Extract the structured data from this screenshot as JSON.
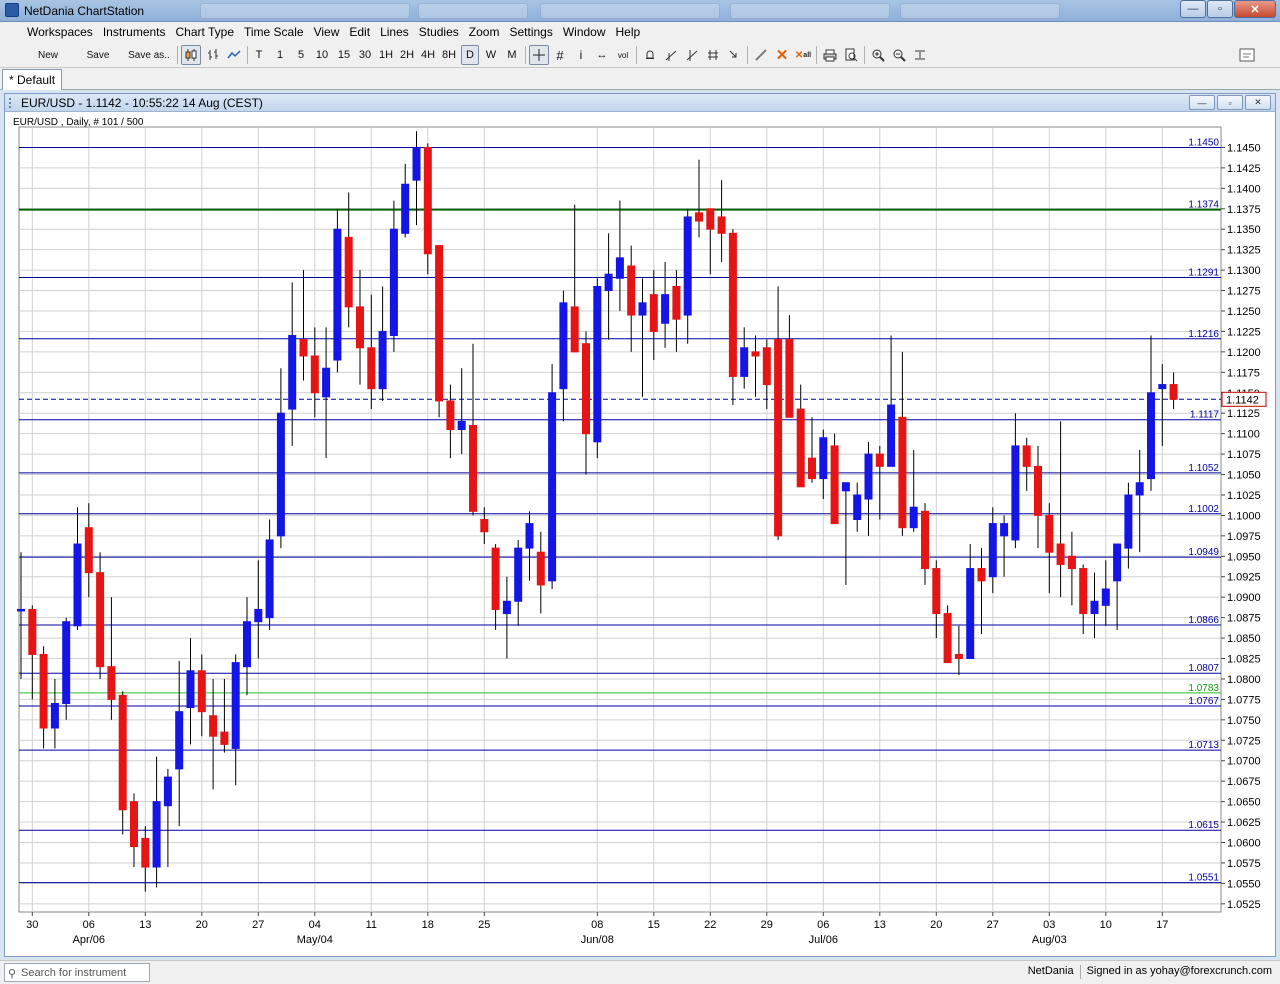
{
  "app": {
    "title": "NetDania ChartStation"
  },
  "window_buttons": {
    "minimize": "—",
    "maximize": "▫",
    "close": "✕"
  },
  "menu": [
    "Workspaces",
    "Instruments",
    "Chart Type",
    "Time Scale",
    "View",
    "Edit",
    "Lines",
    "Studies",
    "Zoom",
    "Settings",
    "Window",
    "Help"
  ],
  "toolbar": {
    "new_label": "New",
    "save_label": "Save",
    "save_as_label": "Save as..",
    "timescales": [
      "T",
      "1",
      "5",
      "10",
      "15",
      "30",
      "1H",
      "2H",
      "4H",
      "8H",
      "D",
      "W",
      "M"
    ],
    "selected_timescale": "D",
    "icons": [
      "candles-icon",
      "bars-icon",
      "line-icon",
      "crosshair-icon",
      "grid-icon",
      "info-icon",
      "arrows-icon",
      "volume-icon",
      "bell-icon",
      "trendline-icon",
      "trend-channel-icon",
      "fork-icon",
      "cursor-arrow-icon",
      "pencil-icon",
      "delete-icon",
      "delete-all-icon",
      "print-icon",
      "print-preview-icon",
      "zoom-in-icon",
      "zoom-out-icon",
      "fit-icon",
      "panel-icon"
    ]
  },
  "workspace_tab": {
    "label": "Default"
  },
  "chart_window": {
    "title": "EUR/USD - 1.1142 - 10:55:22  14 Aug (CEST)",
    "subtitle": "EUR/USD , Daily, # 101 / 500",
    "current_price_label": "1.1142"
  },
  "colors": {
    "up": "#1515e6",
    "down": "#e61515",
    "hline": "#0000a0",
    "hline_green": "#006000",
    "hline_lightgreen": "#22c022",
    "grid": "#d0d0d0",
    "price_box": "#c00000"
  },
  "chart_data": {
    "type": "candlestick",
    "instrument": "EUR/USD",
    "interval": "Daily",
    "ylim": [
      1.0515,
      1.1475
    ],
    "y_ticks": [
      "1.1450",
      "1.1425",
      "1.1400",
      "1.1375",
      "1.1350",
      "1.1325",
      "1.1300",
      "1.1275",
      "1.1250",
      "1.1225",
      "1.1200",
      "1.1175",
      "1.1150",
      "1.1125",
      "1.1100",
      "1.1075",
      "1.1050",
      "1.1025",
      "1.1000",
      "1.0975",
      "1.0950",
      "1.0925",
      "1.0900",
      "1.0875",
      "1.0850",
      "1.0825",
      "1.0800",
      "1.0775",
      "1.0750",
      "1.0725",
      "1.0700",
      "1.0675",
      "1.0650",
      "1.0625",
      "1.0600",
      "1.0575",
      "1.0550",
      "1.0525"
    ],
    "x_ticks": [
      {
        "label": "30",
        "bar": 1
      },
      {
        "label": "06",
        "bar": 6
      },
      {
        "label": "13",
        "bar": 11
      },
      {
        "label": "20",
        "bar": 16
      },
      {
        "label": "27",
        "bar": 21
      },
      {
        "label": "04",
        "bar": 26
      },
      {
        "label": "11",
        "bar": 31
      },
      {
        "label": "18",
        "bar": 36
      },
      {
        "label": "25",
        "bar": 41
      },
      {
        "label": "08",
        "bar": 51
      },
      {
        "label": "15",
        "bar": 56
      },
      {
        "label": "22",
        "bar": 61
      },
      {
        "label": "29",
        "bar": 66
      },
      {
        "label": "06",
        "bar": 71
      },
      {
        "label": "13",
        "bar": 76
      },
      {
        "label": "20",
        "bar": 81
      },
      {
        "label": "27",
        "bar": 86
      },
      {
        "label": "03",
        "bar": 91
      },
      {
        "label": "10",
        "bar": 96
      },
      {
        "label": "17",
        "bar": 101
      }
    ],
    "x_month_labels": [
      {
        "label": "Apr/06",
        "bar": 6
      },
      {
        "label": "May/04",
        "bar": 26
      },
      {
        "label": "Jun/08",
        "bar": 51
      },
      {
        "label": "Jul/06",
        "bar": 71
      },
      {
        "label": "Aug/03",
        "bar": 91
      }
    ],
    "horizontal_lines": [
      {
        "value": 1.145,
        "label": "1.1450",
        "style": "blue"
      },
      {
        "value": 1.1374,
        "label": "1.1374",
        "style": "green"
      },
      {
        "value": 1.1291,
        "label": "1.1291",
        "style": "blue"
      },
      {
        "value": 1.1216,
        "label": "1.1216",
        "style": "blue"
      },
      {
        "value": 1.1117,
        "label": "1.1117",
        "style": "blue"
      },
      {
        "value": 1.1052,
        "label": "1.1052",
        "style": "blue"
      },
      {
        "value": 1.1002,
        "label": "1.1002",
        "style": "blue"
      },
      {
        "value": 1.0949,
        "label": "1.0949",
        "style": "blue"
      },
      {
        "value": 1.0866,
        "label": "1.0866",
        "style": "blue"
      },
      {
        "value": 1.0807,
        "label": "1.0807",
        "style": "blue"
      },
      {
        "value": 1.0783,
        "label": "1.0783",
        "style": "lightgreen"
      },
      {
        "value": 1.0767,
        "label": "1.0767",
        "style": "blue"
      },
      {
        "value": 1.0713,
        "label": "1.0713",
        "style": "blue"
      },
      {
        "value": 1.0615,
        "label": "1.0615",
        "style": "blue"
      },
      {
        "value": 1.0551,
        "label": "1.0551",
        "style": "blue"
      }
    ],
    "current_price": 1.1142,
    "candles": [
      {
        "o": 1.0885,
        "h": 1.0955,
        "l": 1.08,
        "c": 1.0885
      },
      {
        "o": 1.0885,
        "h": 1.089,
        "l": 1.0775,
        "c": 1.083
      },
      {
        "o": 1.083,
        "h": 1.084,
        "l": 1.0715,
        "c": 1.074
      },
      {
        "o": 1.074,
        "h": 1.08,
        "l": 1.0715,
        "c": 1.077
      },
      {
        "o": 1.077,
        "h": 1.0875,
        "l": 1.075,
        "c": 1.087
      },
      {
        "o": 1.0865,
        "h": 1.101,
        "l": 1.086,
        "c": 1.0965
      },
      {
        "o": 1.0985,
        "h": 1.1015,
        "l": 1.09,
        "c": 1.093
      },
      {
        "o": 1.093,
        "h": 1.0955,
        "l": 1.08,
        "c": 1.0815
      },
      {
        "o": 1.0815,
        "h": 1.09,
        "l": 1.075,
        "c": 1.0775
      },
      {
        "o": 1.078,
        "h": 1.0785,
        "l": 1.061,
        "c": 1.064
      },
      {
        "o": 1.065,
        "h": 1.066,
        "l": 1.057,
        "c": 1.0595
      },
      {
        "o": 1.0605,
        "h": 1.062,
        "l": 1.054,
        "c": 1.057
      },
      {
        "o": 1.057,
        "h": 1.0705,
        "l": 1.0545,
        "c": 1.065
      },
      {
        "o": 1.0645,
        "h": 1.069,
        "l": 1.057,
        "c": 1.068
      },
      {
        "o": 1.069,
        "h": 1.0822,
        "l": 1.062,
        "c": 1.076
      },
      {
        "o": 1.0765,
        "h": 1.085,
        "l": 1.072,
        "c": 1.081
      },
      {
        "o": 1.081,
        "h": 1.083,
        "l": 1.073,
        "c": 1.076
      },
      {
        "o": 1.0755,
        "h": 1.08,
        "l": 1.0665,
        "c": 1.073
      },
      {
        "o": 1.0735,
        "h": 1.08,
        "l": 1.071,
        "c": 1.072
      },
      {
        "o": 1.0715,
        "h": 1.083,
        "l": 1.067,
        "c": 1.082
      },
      {
        "o": 1.0815,
        "h": 1.09,
        "l": 1.078,
        "c": 1.087
      },
      {
        "o": 1.087,
        "h": 1.0945,
        "l": 1.0825,
        "c": 1.0885
      },
      {
        "o": 1.0875,
        "h": 1.0995,
        "l": 1.086,
        "c": 1.097
      },
      {
        "o": 1.0975,
        "h": 1.118,
        "l": 1.096,
        "c": 1.1125
      },
      {
        "o": 1.113,
        "h": 1.1285,
        "l": 1.1085,
        "c": 1.122
      },
      {
        "o": 1.1215,
        "h": 1.13,
        "l": 1.1165,
        "c": 1.1195
      },
      {
        "o": 1.1195,
        "h": 1.123,
        "l": 1.112,
        "c": 1.115
      },
      {
        "o": 1.1145,
        "h": 1.123,
        "l": 1.107,
        "c": 1.118
      },
      {
        "o": 1.119,
        "h": 1.1375,
        "l": 1.1175,
        "c": 1.135
      },
      {
        "o": 1.134,
        "h": 1.1395,
        "l": 1.123,
        "c": 1.1255
      },
      {
        "o": 1.1255,
        "h": 1.13,
        "l": 1.116,
        "c": 1.1205
      },
      {
        "o": 1.1205,
        "h": 1.127,
        "l": 1.113,
        "c": 1.1155
      },
      {
        "o": 1.1155,
        "h": 1.128,
        "l": 1.114,
        "c": 1.1225
      },
      {
        "o": 1.122,
        "h": 1.1385,
        "l": 1.12,
        "c": 1.135
      },
      {
        "o": 1.1345,
        "h": 1.143,
        "l": 1.134,
        "c": 1.1405
      },
      {
        "o": 1.141,
        "h": 1.147,
        "l": 1.1355,
        "c": 1.145
      },
      {
        "o": 1.145,
        "h": 1.1455,
        "l": 1.1295,
        "c": 1.132
      },
      {
        "o": 1.133,
        "h": 1.133,
        "l": 1.112,
        "c": 1.114
      },
      {
        "o": 1.114,
        "h": 1.116,
        "l": 1.107,
        "c": 1.1105
      },
      {
        "o": 1.1105,
        "h": 1.118,
        "l": 1.1075,
        "c": 1.1115
      },
      {
        "o": 1.111,
        "h": 1.121,
        "l": 1.1,
        "c": 1.1005
      },
      {
        "o": 1.0995,
        "h": 1.101,
        "l": 1.0965,
        "c": 1.098
      },
      {
        "o": 1.096,
        "h": 1.0965,
        "l": 1.086,
        "c": 1.0885
      },
      {
        "o": 1.088,
        "h": 1.0925,
        "l": 1.0825,
        "c": 1.0895
      },
      {
        "o": 1.0895,
        "h": 1.097,
        "l": 1.0865,
        "c": 1.096
      },
      {
        "o": 1.096,
        "h": 1.1005,
        "l": 1.092,
        "c": 1.099
      },
      {
        "o": 1.0955,
        "h": 1.098,
        "l": 1.088,
        "c": 1.0915
      },
      {
        "o": 1.092,
        "h": 1.1185,
        "l": 1.091,
        "c": 1.115
      },
      {
        "o": 1.1155,
        "h": 1.1275,
        "l": 1.1115,
        "c": 1.126
      },
      {
        "o": 1.1255,
        "h": 1.138,
        "l": 1.12,
        "c": 1.12
      },
      {
        "o": 1.121,
        "h": 1.1225,
        "l": 1.105,
        "c": 1.11
      },
      {
        "o": 1.109,
        "h": 1.129,
        "l": 1.107,
        "c": 1.128
      },
      {
        "o": 1.1275,
        "h": 1.1345,
        "l": 1.1215,
        "c": 1.1295
      },
      {
        "o": 1.129,
        "h": 1.1385,
        "l": 1.125,
        "c": 1.1315
      },
      {
        "o": 1.1305,
        "h": 1.133,
        "l": 1.12,
        "c": 1.1245
      },
      {
        "o": 1.1245,
        "h": 1.129,
        "l": 1.1145,
        "c": 1.126
      },
      {
        "o": 1.127,
        "h": 1.13,
        "l": 1.119,
        "c": 1.1225
      },
      {
        "o": 1.1235,
        "h": 1.131,
        "l": 1.1205,
        "c": 1.127
      },
      {
        "o": 1.128,
        "h": 1.13,
        "l": 1.12,
        "c": 1.124
      },
      {
        "o": 1.1245,
        "h": 1.1375,
        "l": 1.121,
        "c": 1.1365
      },
      {
        "o": 1.137,
        "h": 1.1435,
        "l": 1.134,
        "c": 1.136
      },
      {
        "o": 1.1375,
        "h": 1.137,
        "l": 1.1295,
        "c": 1.135
      },
      {
        "o": 1.1365,
        "h": 1.141,
        "l": 1.131,
        "c": 1.1345
      },
      {
        "o": 1.1345,
        "h": 1.135,
        "l": 1.1135,
        "c": 1.117
      },
      {
        "o": 1.117,
        "h": 1.123,
        "l": 1.1155,
        "c": 1.1205
      },
      {
        "o": 1.12,
        "h": 1.122,
        "l": 1.1145,
        "c": 1.1195
      },
      {
        "o": 1.1205,
        "h": 1.1215,
        "l": 1.113,
        "c": 1.116
      },
      {
        "o": 1.1215,
        "h": 1.128,
        "l": 1.097,
        "c": 1.0975
      },
      {
        "o": 1.1215,
        "h": 1.1245,
        "l": 1.112,
        "c": 1.112
      },
      {
        "o": 1.113,
        "h": 1.116,
        "l": 1.1035,
        "c": 1.1035
      },
      {
        "o": 1.107,
        "h": 1.112,
        "l": 1.104,
        "c": 1.1045
      },
      {
        "o": 1.1045,
        "h": 1.1105,
        "l": 1.102,
        "c": 1.1095
      },
      {
        "o": 1.1085,
        "h": 1.11,
        "l": 1.099,
        "c": 1.099
      },
      {
        "o": 1.103,
        "h": 1.104,
        "l": 1.0915,
        "c": 1.104
      },
      {
        "o": 1.0995,
        "h": 1.104,
        "l": 1.098,
        "c": 1.1025
      },
      {
        "o": 1.102,
        "h": 1.109,
        "l": 1.0975,
        "c": 1.1075
      },
      {
        "o": 1.1075,
        "h": 1.1085,
        "l": 1.0995,
        "c": 1.106
      },
      {
        "o": 1.106,
        "h": 1.122,
        "l": 1.106,
        "c": 1.1135
      },
      {
        "o": 1.112,
        "h": 1.12,
        "l": 1.0975,
        "c": 1.0985
      },
      {
        "o": 1.0985,
        "h": 1.108,
        "l": 1.098,
        "c": 1.101
      },
      {
        "o": 1.1005,
        "h": 1.1015,
        "l": 1.0915,
        "c": 1.0935
      },
      {
        "o": 1.0935,
        "h": 1.0945,
        "l": 1.085,
        "c": 1.088
      },
      {
        "o": 1.088,
        "h": 1.089,
        "l": 1.082,
        "c": 1.082
      },
      {
        "o": 1.083,
        "h": 1.0865,
        "l": 1.0805,
        "c": 1.0825
      },
      {
        "o": 1.0825,
        "h": 1.0965,
        "l": 1.0825,
        "c": 1.0935
      },
      {
        "o": 1.0935,
        "h": 1.096,
        "l": 1.0855,
        "c": 1.092
      },
      {
        "o": 1.0925,
        "h": 1.101,
        "l": 1.0905,
        "c": 1.099
      },
      {
        "o": 1.0975,
        "h": 1.1,
        "l": 1.0925,
        "c": 1.099
      },
      {
        "o": 1.097,
        "h": 1.1125,
        "l": 1.096,
        "c": 1.1085
      },
      {
        "o": 1.1085,
        "h": 1.1095,
        "l": 1.103,
        "c": 1.106
      },
      {
        "o": 1.106,
        "h": 1.1085,
        "l": 1.096,
        "c": 1.1
      },
      {
        "o": 1.1,
        "h": 1.1015,
        "l": 1.0905,
        "c": 1.0955
      },
      {
        "o": 1.0965,
        "h": 1.1115,
        "l": 1.09,
        "c": 1.094
      },
      {
        "o": 1.095,
        "h": 1.098,
        "l": 1.089,
        "c": 1.0935
      },
      {
        "o": 1.0935,
        "h": 1.094,
        "l": 1.0855,
        "c": 1.088
      },
      {
        "o": 1.088,
        "h": 1.093,
        "l": 1.085,
        "c": 1.0895
      },
      {
        "o": 1.089,
        "h": 1.0945,
        "l": 1.0865,
        "c": 1.091
      },
      {
        "o": 1.092,
        "h": 1.096,
        "l": 1.086,
        "c": 1.0965
      },
      {
        "o": 1.096,
        "h": 1.104,
        "l": 1.0935,
        "c": 1.1025
      },
      {
        "o": 1.1025,
        "h": 1.108,
        "l": 1.0955,
        "c": 1.104
      },
      {
        "o": 1.1045,
        "h": 1.122,
        "l": 1.103,
        "c": 1.115
      },
      {
        "o": 1.1155,
        "h": 1.1185,
        "l": 1.1085,
        "c": 1.116
      },
      {
        "o": 1.116,
        "h": 1.1175,
        "l": 1.113,
        "c": 1.1142
      }
    ]
  },
  "statusbar": {
    "search_placeholder": "Search for instrument",
    "brand": "NetDania",
    "signed_in": "Signed in as yohay@forexcrunch.com"
  }
}
